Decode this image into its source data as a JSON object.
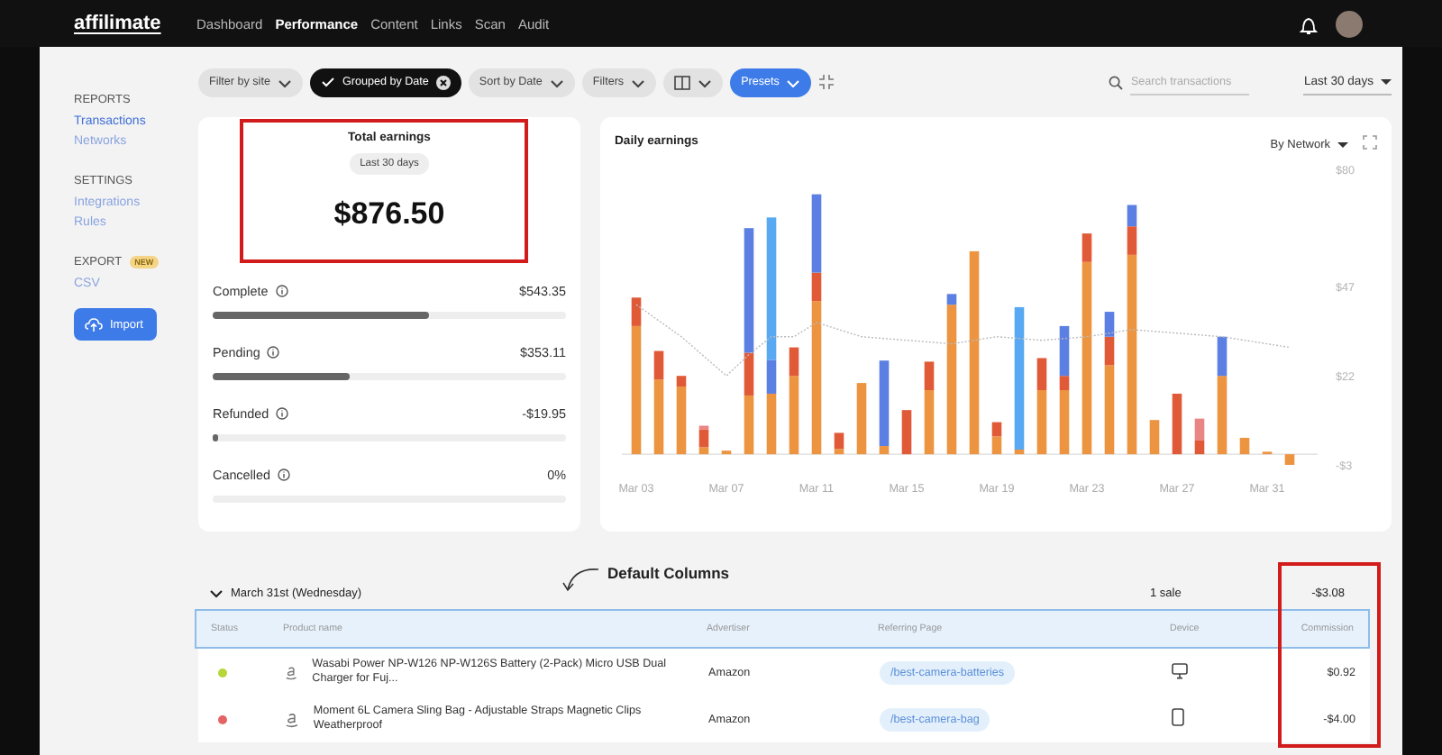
{
  "nav": {
    "logo": "affilimate",
    "links": [
      {
        "label": "Dashboard",
        "selected": false
      },
      {
        "label": "Performance",
        "selected": true
      },
      {
        "label": "Content",
        "selected": false
      },
      {
        "label": "Links",
        "selected": false
      },
      {
        "label": "Scan",
        "selected": false
      },
      {
        "label": "Audit",
        "selected": false
      }
    ]
  },
  "sidebar": {
    "sections": [
      {
        "heading": "REPORTS",
        "items": [
          {
            "label": "Transactions",
            "selected": true
          },
          {
            "label": "Networks",
            "selected": false
          }
        ]
      },
      {
        "heading": "SETTINGS",
        "items": [
          {
            "label": "Integrations",
            "selected": false
          },
          {
            "label": "Rules",
            "selected": false
          }
        ]
      },
      {
        "heading": "EXPORT",
        "badge": "NEW",
        "items": [
          {
            "label": "CSV",
            "selected": false
          }
        ]
      }
    ],
    "import_button": "Import"
  },
  "toolbar": {
    "filters": [
      {
        "kind": "dropdown",
        "label": "Filter by site"
      },
      {
        "kind": "active",
        "label": "Grouped by Date"
      },
      {
        "kind": "dropdown",
        "label": "Sort by Date"
      },
      {
        "kind": "dropdown",
        "label": "Filters"
      },
      {
        "kind": "columns"
      },
      {
        "kind": "primary",
        "label": "Presets"
      }
    ],
    "search": {
      "placeholder": "Search transactions"
    },
    "date_range": "Last 30 days"
  },
  "summary": {
    "title": "Total earnings",
    "period": "Last 30 days",
    "total": "$876.50",
    "statuses": [
      {
        "label": "Complete",
        "amount": "$543.35",
        "level": 0.61
      },
      {
        "label": "Pending",
        "amount": "$353.11",
        "level": 0.39
      },
      {
        "label": "Refunded",
        "amount": "-$19.95",
        "level": 0.015
      },
      {
        "label": "Cancelled",
        "amount": "0%"
      }
    ]
  },
  "chart": {
    "title": "Daily earnings",
    "group_by": "By Network",
    "chart_data": {
      "type": "bar",
      "stacked": true,
      "categories": [
        "Mar 03",
        null,
        null,
        null,
        "Mar 07",
        null,
        null,
        null,
        "Mar 11",
        null,
        null,
        null,
        "Mar 15",
        null,
        null,
        null,
        "Mar 19",
        null,
        null,
        null,
        "Mar 23",
        null,
        null,
        null,
        "Mar 27",
        null,
        null,
        null,
        "Mar 31",
        null
      ],
      "yticks": [
        {
          "value": 80,
          "label": "$80"
        },
        {
          "value": 47,
          "label": "$47"
        },
        {
          "value": 22,
          "label": "$22"
        },
        {
          "value": -3,
          "label": "-$3"
        }
      ],
      "ylim": [
        -3,
        80
      ],
      "series": [
        {
          "color": "#ec9440",
          "values": [
            36,
            21,
            19,
            2,
            1,
            16.5,
            17,
            22,
            43,
            1.5,
            20,
            2.3,
            null,
            18,
            42,
            57,
            5,
            1.3,
            18,
            18,
            54,
            25,
            56,
            9.6,
            null,
            null,
            22,
            4.6,
            0.7,
            -3
          ]
        },
        {
          "color": "#e05a38",
          "values": [
            8,
            8,
            3,
            5,
            null,
            12,
            null,
            8,
            8,
            4.5,
            null,
            null,
            12.4,
            8,
            null,
            null,
            4,
            null,
            9,
            4,
            8,
            8,
            8,
            null,
            17,
            4,
            null,
            null,
            null,
            null
          ]
        },
        {
          "color": "#5b7fe2",
          "values": [
            null,
            null,
            null,
            null,
            null,
            35,
            9.5,
            null,
            22,
            null,
            null,
            24,
            null,
            null,
            3,
            null,
            null,
            null,
            null,
            14,
            null,
            7,
            6,
            null,
            null,
            null,
            11,
            null,
            null,
            null
          ]
        },
        {
          "color": "#58a8f2",
          "values": [
            null,
            null,
            null,
            null,
            null,
            null,
            40,
            null,
            null,
            null,
            null,
            null,
            null,
            null,
            null,
            null,
            null,
            40,
            null,
            null,
            null,
            null,
            null,
            null,
            null,
            null,
            null,
            null,
            null,
            null
          ]
        },
        {
          "color": "#ea8585",
          "values": [
            null,
            null,
            null,
            1,
            null,
            null,
            null,
            null,
            null,
            null,
            null,
            null,
            null,
            null,
            null,
            null,
            null,
            null,
            null,
            null,
            null,
            null,
            null,
            null,
            null,
            6,
            null,
            null,
            null,
            null
          ]
        },
        {
          "type": "line",
          "line_style": "dotted",
          "color": "#bbbbbb",
          "values": [
            42,
            37.5,
            33,
            27.5,
            22,
            28,
            33,
            33,
            37,
            35,
            33,
            32.5,
            32,
            31.5,
            31,
            32,
            33,
            32.5,
            32,
            32.5,
            33,
            34,
            35,
            34.5,
            34,
            33.5,
            33,
            32,
            31,
            30
          ]
        }
      ]
    }
  },
  "annotation": "Default Columns",
  "transactions": {
    "group": {
      "date": "March 31st (Wednesday)",
      "count": "1 sale",
      "total": "-$3.08",
      "expanded": true
    },
    "columns": [
      "Status",
      "Product name",
      "Advertiser",
      "Referring Page",
      "Device",
      "Commission"
    ],
    "rows": [
      {
        "color": "#b7d63a",
        "product": "Wasabi Power NP-W126 NP-W126S Battery (2-Pack) Micro USB Dual Charger for Fuj...",
        "advertiser": "Amazon",
        "page": "/best-camera-batteries",
        "kind": "desktop",
        "commission": "$0.92"
      },
      {
        "color": "#e46464",
        "product": "Moment 6L Camera Sling Bag - Adjustable Straps Magnetic Clips Weatherproof",
        "advertiser": "Amazon",
        "page": "/best-camera-bag",
        "kind": "mobile",
        "commission": "-$4.00"
      }
    ]
  }
}
